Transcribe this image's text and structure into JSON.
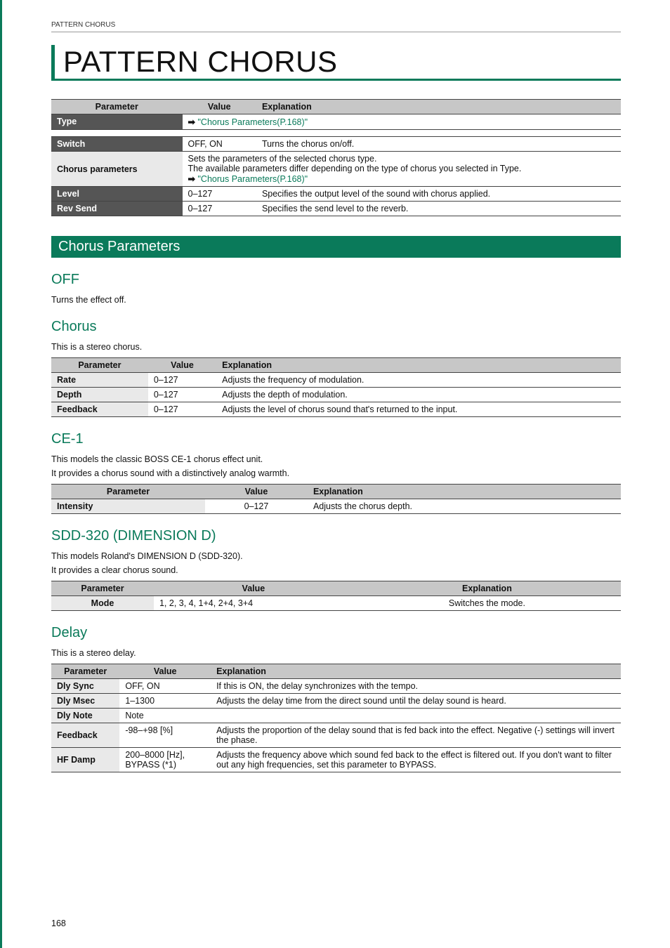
{
  "crumb": "PATTERN CHORUS",
  "pageTitle": "PATTERN CHORUS",
  "pageNumber": "168",
  "columns": {
    "param": "Parameter",
    "value": "Value",
    "expl": "Explanation"
  },
  "linkText": "\"Chorus Parameters(P.168)\"",
  "mainTable": {
    "rows": [
      {
        "param": "Type",
        "value": "",
        "expl_is_link": true,
        "dark": true
      },
      {
        "param": "Switch",
        "value": "OFF, ON",
        "expl": "Turns the chorus on/off."
      },
      {
        "param": "Chorus parameters",
        "value": "",
        "expl_multiline": [
          "Sets the parameters of the selected chorus type.",
          "The available parameters differ depending on the type of chorus you selected in Type."
        ],
        "link_after": true
      },
      {
        "param": "Level",
        "value": "0–127",
        "expl": "Specifies the output level of the sound with chorus applied."
      },
      {
        "param": "Rev Send",
        "value": "0–127",
        "expl": "Specifies the send level to the reverb."
      }
    ]
  },
  "sectionTitle": "Chorus Parameters",
  "off": {
    "heading": "OFF",
    "text": "Turns the effect off."
  },
  "chorus": {
    "heading": "Chorus",
    "text": "This is a stereo chorus.",
    "rows": [
      {
        "param": "Rate",
        "value": "0–127",
        "expl": "Adjusts the frequency of modulation."
      },
      {
        "param": "Depth",
        "value": "0–127",
        "expl": "Adjusts the depth of modulation."
      },
      {
        "param": "Feedback",
        "value": "0–127",
        "expl": "Adjusts the level of chorus sound that's returned to the input."
      }
    ]
  },
  "ce1": {
    "heading": "CE-1",
    "text1": "This models the classic BOSS CE-1 chorus effect unit.",
    "text2": "It provides a chorus sound with a distinctively analog warmth.",
    "rows": [
      {
        "param": "Intensity",
        "value": "0–127",
        "expl": "Adjusts the chorus depth."
      }
    ]
  },
  "sdd": {
    "heading": "SDD-320 (DIMENSION D)",
    "text1": "This models Roland's DIMENSION D (SDD-320).",
    "text2": "It provides a clear chorus sound.",
    "rows": [
      {
        "param": "Mode",
        "value": "1, 2, 3, 4, 1+4, 2+4, 3+4",
        "expl": "Switches the mode."
      }
    ]
  },
  "delay": {
    "heading": "Delay",
    "text": "This is a stereo delay.",
    "rows": [
      {
        "param": "Dly Sync",
        "value": "OFF, ON",
        "expl": "If this is ON, the delay synchronizes with the tempo."
      },
      {
        "param": "Dly Msec",
        "value": "1–1300",
        "expl": "Adjusts the delay time from the direct sound until the delay sound is heard."
      },
      {
        "param": "Dly Note",
        "value": "Note",
        "expl": ""
      },
      {
        "param": "Feedback",
        "value": "-98–+98 [%]",
        "expl": "Adjusts the proportion of the delay sound that is fed back into the effect. Negative (-) settings will invert the phase."
      },
      {
        "param": "HF Damp",
        "value": "200–8000 [Hz], BYPASS (*1)",
        "expl": "Adjusts the frequency above which sound fed back to the effect is filtered out. If you don't want to filter out any high frequencies, set this parameter to BYPASS."
      }
    ]
  }
}
